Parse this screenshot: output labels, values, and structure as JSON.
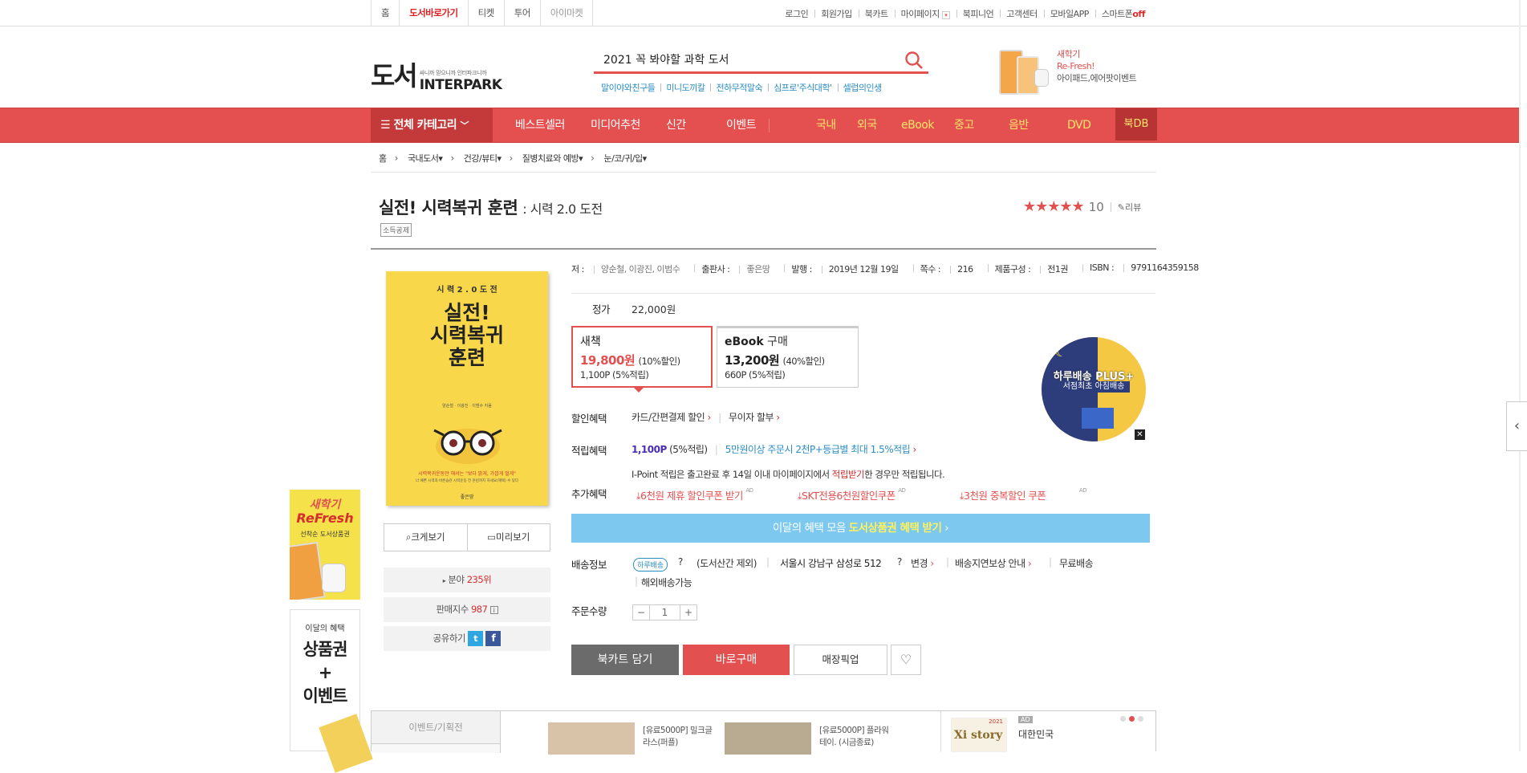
{
  "topnav": {
    "left": [
      {
        "label": "홈",
        "active": false
      },
      {
        "label": "도서바로가기",
        "active": true
      },
      {
        "label": "티켓",
        "active": false
      },
      {
        "label": "투어",
        "active": false
      },
      {
        "label": "아이마켓",
        "active": false
      }
    ],
    "right": [
      "로그인",
      "회원가입",
      "북카트",
      "마이페이지",
      "북피니언",
      "고객센터",
      "모바일APP"
    ],
    "smart_label": "스마트폰",
    "smart_state": "off"
  },
  "header": {
    "logo_kr": "도서",
    "logo_tag": "싸니까 믿으니까 인터파크니까",
    "logo_brand": "INTERPARK",
    "search_value": "2021 꼭 봐야할 과학 도서",
    "keywords": [
      "말이야와친구들",
      "미니도끼칼",
      "전하무적말숙",
      "심프로'주식대학'",
      "셀럽의인생"
    ],
    "promo": {
      "line1": "새학기",
      "line2": "Re-Fresh!",
      "line3": "아이패드,에어팟이벤트"
    }
  },
  "navbar": {
    "all_category": "전체 카테고리",
    "main": [
      "베스트셀러",
      "미디어추천",
      "신간",
      "이벤트"
    ],
    "sub": [
      "국내",
      "외국",
      "eBook",
      "중고",
      "음반",
      "DVD"
    ],
    "bookdb": "북DB"
  },
  "breadcrumb": [
    "홈",
    "국내도서",
    "건강/뷰티",
    "질병치료와 예방",
    "눈/코/귀/입"
  ],
  "product": {
    "title": "실전! 시력복귀 훈련",
    "subtitle": ": 시력 2.0 도전",
    "tax_badge": "소득공제",
    "rating_stars": "★★★★★",
    "rating_score": "10",
    "review_label": "리뷰",
    "cover": {
      "top": "시 력  2 . 0  도 전",
      "title1": "실전!",
      "title2": "시력복귀",
      "title3": "훈련",
      "authors": "양순철 · 이광진 · 이범수 지음",
      "tagline": "시력복귀운동만 해서는 \"보다 밝게, 가깝게 멀게\"",
      "tagline2": "너 예쁜 시력과 바른습관 시력운동 전 훈련까지 하세요(혜택) 수 있다",
      "publisher": "좋은땅"
    },
    "meta": [
      {
        "label": "저 :",
        "value": "양순철, 이광진, 이범수"
      },
      {
        "label": "출판사 :",
        "value": "좋은땅"
      },
      {
        "label": "발행 :",
        "value": "2019년 12월 19일"
      },
      {
        "label": "쪽수 :",
        "value": "216"
      },
      {
        "label": "제품구성 :",
        "value": "전1권"
      },
      {
        "label": "ISBN :",
        "value": "9791164359158"
      }
    ],
    "price_label": "정가",
    "price": "22,000원",
    "options": [
      {
        "name": "새책",
        "price": "19,800원",
        "discount": "(10%할인)",
        "points": "1,100P (5%적립)"
      },
      {
        "name": "eBook",
        "name_suffix": "구매",
        "price": "13,200원",
        "discount": "(40%할인)",
        "points": "660P (5%적립)"
      }
    ],
    "discount_label": "할인혜택",
    "discount_items": [
      "카드/간편결제 할인",
      "무이자 할부"
    ],
    "points_label": "적립혜택",
    "points_value": "1,100P",
    "points_rate": "(5%적립)",
    "points_extra": "5만원이상 주문시 2천P+등급별 최대 1.5%적립",
    "ipoint_text_a": "I-Point 적립은 출고완료 후 14일 이내 마이페이지에서",
    "ipoint_text_b": "적립받기",
    "ipoint_text_c": "한 경우만 적립됩니다.",
    "extra_label": "추가혜택",
    "extra_items": [
      "6천원 제휴 할인쿠폰 받기",
      "SKT전용6천원할인쿠폰",
      "3천원 중복할인 쿠폰"
    ],
    "ad_tag": "AD",
    "month_bar_a": "이달의 혜택 모음",
    "month_bar_b": "도서상품권 혜택 받기",
    "delivery_label": "배송정보",
    "delivery_badge": "하루배송",
    "delivery_exclude": "(도서산간 제외)",
    "delivery_address": "서울시 강남구 삼성로 512",
    "delivery_change": "변경",
    "delivery_comp": "배송지연보상 안내",
    "delivery_free": "무료배송",
    "delivery_overseas": "해외배송가능",
    "qty_label": "주문수량",
    "qty": "1",
    "btn_cart": "북카트 담기",
    "btn_buy": "바로구매",
    "btn_pickup": "매장픽업",
    "view_btns": [
      "크게보기",
      "미리보기"
    ],
    "rank_label": "분야",
    "rank_value": "235위",
    "sales_label": "판매지수",
    "sales_value": "987",
    "share_label": "공유하기",
    "badge": {
      "line1": "하루배송 PLUS+",
      "line2": "서점최초 아침배송"
    }
  },
  "side_banners": {
    "b1": {
      "line1": "새학기",
      "line2": "ReFresh",
      "line3": "선착순 도서상품권"
    },
    "b2": {
      "line1": "이달의 혜택",
      "line2": "상품권",
      "line3": "+",
      "line4": "이벤트"
    }
  },
  "bottom": {
    "tab": "이벤트/기획전",
    "items": [
      {
        "line1": "[유료5000P] 밀크글",
        "line2": "라스(퍼플)"
      },
      {
        "line1": "[유료5000P] 플라워",
        "line2": "테이. (시금종료)"
      }
    ],
    "ad_tag": "AD",
    "ad_text": "대한민국",
    "ad_year": "2021",
    "ad_brand": "Xi story"
  }
}
